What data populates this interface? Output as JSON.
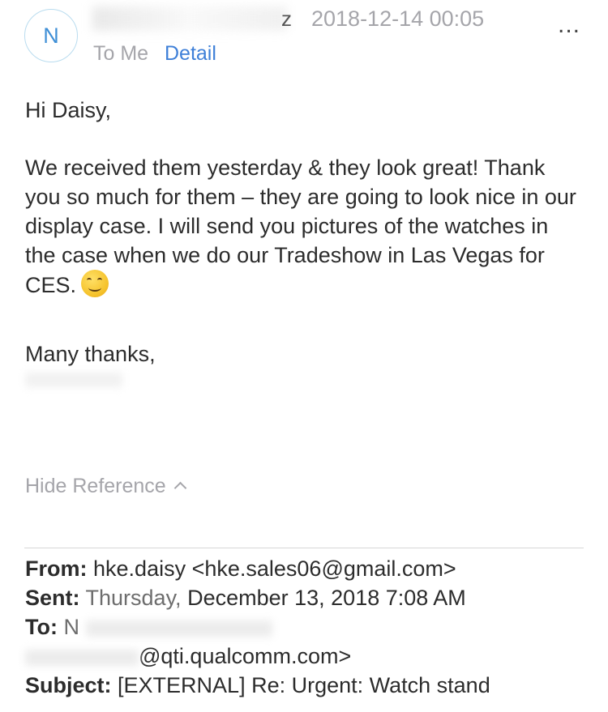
{
  "header": {
    "avatar_initial": "N",
    "sender_visible_tail": "z",
    "date": "2018-12-14 00:05",
    "to_label": "To Me",
    "detail_label": "Detail",
    "more_label": "..."
  },
  "message": {
    "greeting": "Hi Daisy,",
    "paragraph": "We received them yesterday & they look great! Thank you so much for them – they are going to look nice in our display case. I will send you pictures of the watches in the case when we do our Tradeshow in Las Vegas for CES.",
    "closing": "Many thanks,"
  },
  "reference": {
    "toggle_label": "Hide Reference",
    "from_label": "From:",
    "from_value": "hke.daisy <hke.sales06@gmail.com>",
    "sent_label": "Sent:",
    "sent_value_a": "Thursday, ",
    "sent_value_b": "December 13, 2018 7:08 AM",
    "to_label": "To:",
    "to_visible": "N",
    "to_email_domain": "@qti.qualcomm.com>",
    "subject_label": "Subject:",
    "subject_value": "[EXTERNAL] Re: Urgent: Watch stand"
  },
  "icons": {
    "more": "more-horizontal-icon",
    "emoji": "smiling-face-icon",
    "chevron": "chevron-up-icon"
  },
  "colors": {
    "accent": "#3f80d8",
    "muted": "#a5a5aa",
    "text": "#2c2c2c",
    "avatar_border": "#b9dcef"
  }
}
